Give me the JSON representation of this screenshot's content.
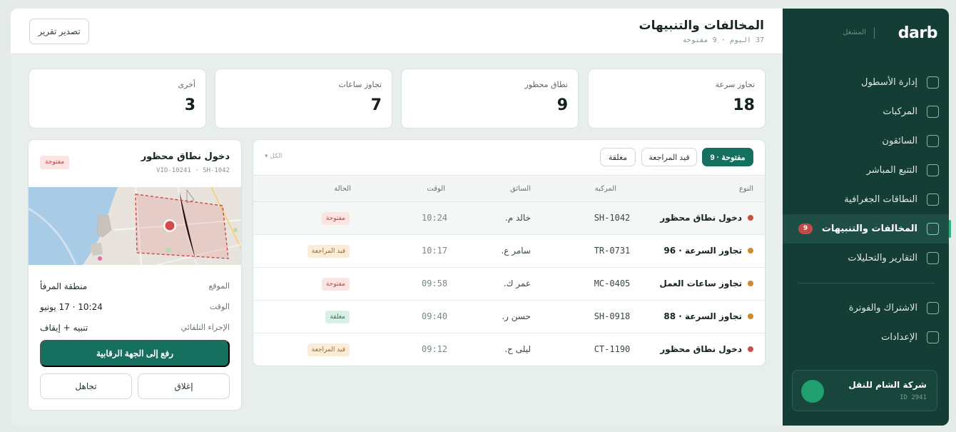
{
  "brand": {
    "name": "darb",
    "subtitle": "المشغل"
  },
  "sidebar": {
    "items": [
      {
        "label": "إدارة الأسطول"
      },
      {
        "label": "المركبات"
      },
      {
        "label": "السائقون"
      },
      {
        "label": "التتبع المباشر"
      },
      {
        "label": "النطاقات الجغرافية"
      },
      {
        "label": "المخالفات والتنبيهات",
        "badge": "9",
        "active": true
      },
      {
        "label": "التقارير والتحليلات"
      }
    ],
    "secondary": [
      {
        "label": "الاشتراك والفوترة"
      },
      {
        "label": "الإعدادات"
      }
    ],
    "account": {
      "name": "شركة الشام للنقل",
      "id": "ID 2941"
    }
  },
  "header": {
    "title": "المخالفات والتنبيهات",
    "subtitle": "37 اليوم · 9 مفتوحة",
    "export_label": "تصدير تقرير"
  },
  "stats": [
    {
      "label": "تجاوز سرعة",
      "value": "18"
    },
    {
      "label": "نطاق محظور",
      "value": "9"
    },
    {
      "label": "تجاوز ساعات",
      "value": "7"
    },
    {
      "label": "أخرى",
      "value": "3"
    }
  ],
  "filters": {
    "chips": [
      "مفتوحة · 9",
      "قيد المراجعة",
      "مغلقة"
    ],
    "select": "الكل"
  },
  "table": {
    "headers": {
      "type": "النوع",
      "vehicle": "المركبة",
      "driver": "السائق",
      "time": "الوقت",
      "status": "الحالة"
    },
    "rows": [
      {
        "type": "دخول نطاق محظور",
        "dot": "#c9504a",
        "vehicle": "SH-1042",
        "driver": "خالد م.",
        "time": "10:24",
        "status": "مفتوحة",
        "status_kind": "open"
      },
      {
        "type": "تجاوز السرعة · 96",
        "dot": "#d08a2e",
        "vehicle": "TR-0731",
        "driver": "سامر ع.",
        "time": "10:17",
        "status": "قيد المراجعة",
        "status_kind": "review"
      },
      {
        "type": "تجاوز ساعات العمل",
        "dot": "#d08a2e",
        "vehicle": "MC-0405",
        "driver": "عمر ك.",
        "time": "09:58",
        "status": "مفتوحة",
        "status_kind": "open"
      },
      {
        "type": "تجاوز السرعة · 88",
        "dot": "#d08a2e",
        "vehicle": "SH-0918",
        "driver": "حسن ر.",
        "time": "09:40",
        "status": "مغلقة",
        "status_kind": "closed"
      },
      {
        "type": "دخول نطاق محظور",
        "dot": "#c9504a",
        "vehicle": "CT-1190",
        "driver": "ليلى ح.",
        "time": "09:12",
        "status": "قيد المراجعة",
        "status_kind": "review"
      }
    ]
  },
  "detail": {
    "title": "دخول نطاق محظور",
    "subtitle": "VIO-10241 · SH-1042",
    "status": "مفتوحة",
    "fields": [
      {
        "label": "الموقع",
        "value": "منطقة المرفأ"
      },
      {
        "label": "الوقت",
        "value": "10:24 · 17 يونيو"
      },
      {
        "label": "الإجراء التلقائي",
        "value": "تنبيه + إيقاف"
      }
    ],
    "primary_action": "رفع إلى الجهة الرقابية",
    "close_action": "إغلاق",
    "ignore_action": "تجاهل"
  },
  "colors": {
    "accent": "#16705f",
    "sidebar_bg": "#133d35",
    "danger": "#c9504a",
    "warning": "#d08a2e"
  }
}
